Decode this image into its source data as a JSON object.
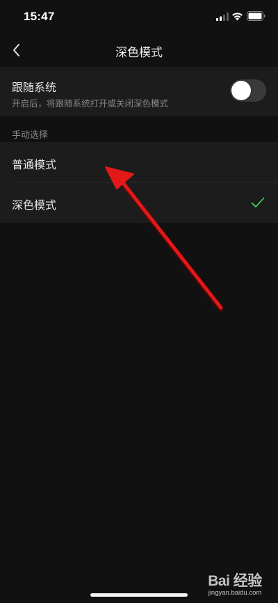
{
  "status_bar": {
    "time": "15:47",
    "icons": [
      "signal-icon",
      "wifi-icon",
      "battery-icon"
    ]
  },
  "nav": {
    "back_icon": "chevron-left-icon",
    "title": "深色模式"
  },
  "follow_system": {
    "title": "跟随系统",
    "subtitle": "开启后，将跟随系统打开或关闭深色模式",
    "toggle_on": false
  },
  "manual": {
    "section_label": "手动选择",
    "options": [
      {
        "label": "普通模式",
        "selected": false
      },
      {
        "label": "深色模式",
        "selected": true
      }
    ]
  },
  "annotation": {
    "type": "red-arrow",
    "color": "#e31818",
    "points_to": "普通模式"
  },
  "watermark": {
    "logo": "Bai 经验",
    "url": "jingyan.baidu.com"
  },
  "colors": {
    "background": "#111111",
    "row_background": "#1c1c1c",
    "check": "#4cd964",
    "toggle_off": "#3a3a3c"
  }
}
